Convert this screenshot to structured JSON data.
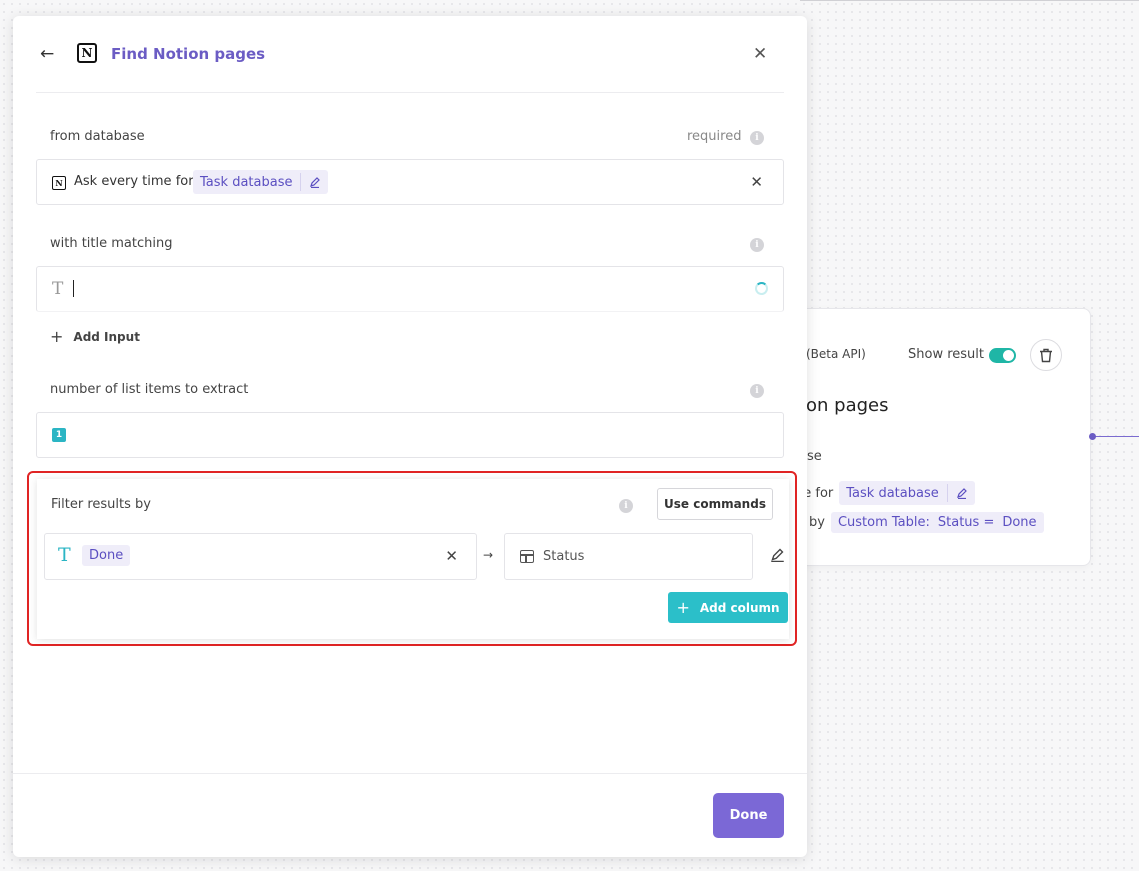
{
  "background_card": {
    "api_label": "(Beta API)",
    "show_result_label": "Show result",
    "title_fragment": "on pages",
    "line1_fragment": "se",
    "line2_fragment": "ne for",
    "line2_chip": "Task database",
    "line3_fragment": "by",
    "line3_chip_a": "Custom Table:",
    "line3_chip_b": "Status =",
    "line3_chip_c": "Done"
  },
  "header": {
    "title": "Find Notion pages",
    "back_glyph": "←",
    "close_glyph": "✕",
    "logo_letter": "N"
  },
  "from_database": {
    "label": "from database",
    "required": "required",
    "text": "Ask every time for",
    "chip": "Task database",
    "clear_glyph": "✕"
  },
  "title_matching": {
    "label": "with title matching",
    "type_glyph": "T"
  },
  "add_input": {
    "label": "Add Input",
    "plus": "+"
  },
  "list_items": {
    "label": "number of list items to extract",
    "value": "1"
  },
  "filter": {
    "label": "Filter results by",
    "use_commands": "Use commands",
    "value_chip": "Done",
    "type_glyph": "T",
    "clear_glyph": "✕",
    "arrow": "→",
    "column": "Status",
    "add_column": "Add column",
    "plus": "+"
  },
  "footer": {
    "done_label": "Done"
  },
  "colors": {
    "accent_purple": "#6b5cc4",
    "button_purple": "#7b68d6",
    "teal": "#2bbfc9",
    "highlight_red": "#e02424"
  }
}
